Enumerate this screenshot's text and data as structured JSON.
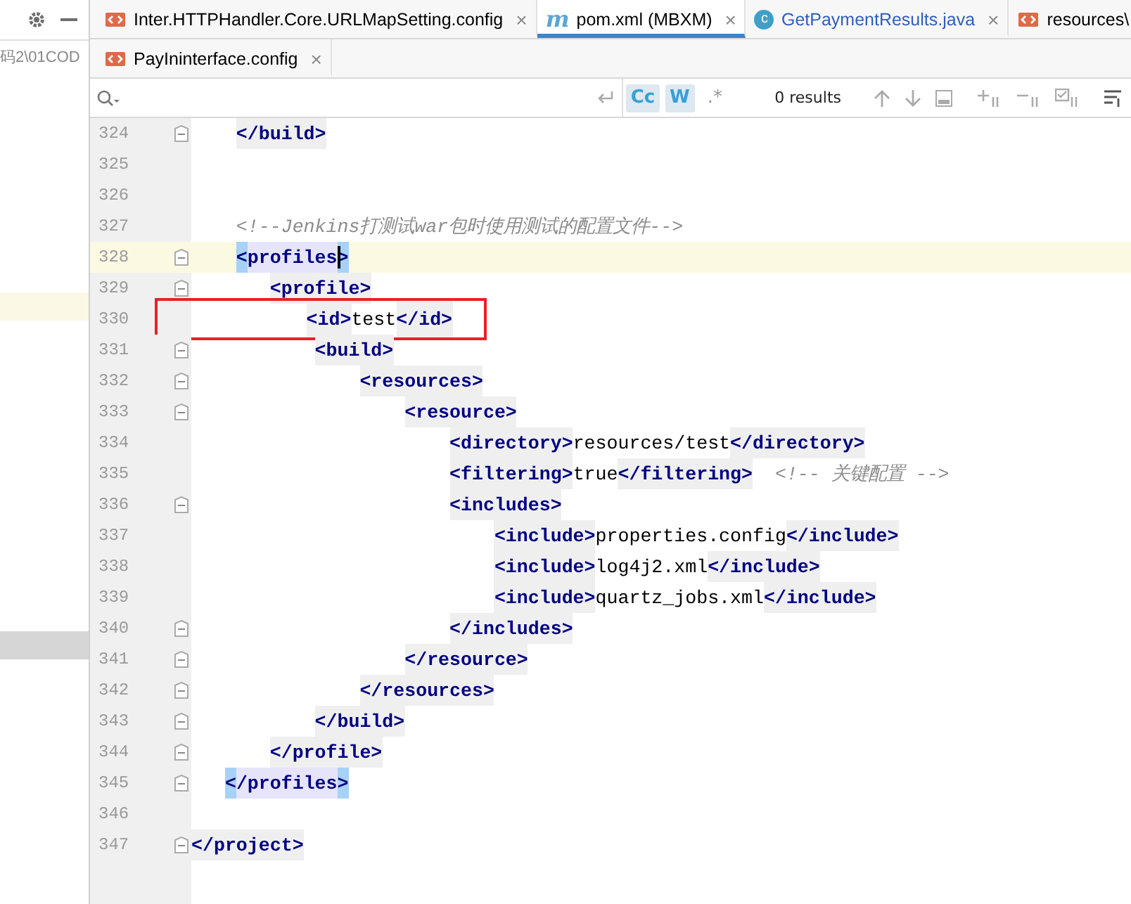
{
  "project_panel": {
    "path": "码2\\01COD",
    "rows": [
      {
        "kind": "highlight"
      },
      {
        "kind": "grey"
      }
    ]
  },
  "tabs": [
    {
      "label": "Inter.HTTPHandler.Core.URLMapSetting.config",
      "icon": {
        "kind": "xml"
      },
      "selected": false,
      "close": "×",
      "color": "#000000"
    },
    {
      "label": "pom.xml (MBXM)",
      "icon": {
        "kind": "maven",
        "glyph": "m"
      },
      "selected": true,
      "close": "×",
      "color": "#000000"
    },
    {
      "label": "GetPaymentResults.java",
      "icon": {
        "kind": "class",
        "glyph": "c"
      },
      "selected": false,
      "close": "×",
      "color": "#2f5fbf"
    },
    {
      "label": "resources\\",
      "icon": {
        "kind": "xml"
      },
      "selected": false,
      "color": "#000000"
    },
    {
      "label": "PayIninterface.config",
      "icon": {
        "kind": "xml"
      },
      "selected": false,
      "close": "×",
      "color": "#000000"
    }
  ],
  "search": {
    "results": "0 results",
    "match_case": {
      "label": "Cc",
      "selected": true
    },
    "words": {
      "label": "W",
      "selected": true
    },
    "regex": {
      "label": ".*",
      "selected": false
    }
  },
  "lines": [
    {
      "number": "324",
      "fold": true,
      "current": false,
      "tokens": [
        {
          "kind": "tag",
          "text": "    </build>"
        }
      ]
    },
    {
      "number": "325",
      "fold": false,
      "current": false
    },
    {
      "number": "326",
      "fold": false,
      "current": false
    },
    {
      "number": "327",
      "fold": false,
      "current": false,
      "tokens": [
        {
          "kind": "comment",
          "text": "    <!--Jenkins打测试war包时使用测试的配置文件-->"
        }
      ]
    },
    {
      "number": "328",
      "fold": true,
      "current": true,
      "tokens": [
        {
          "kind": "match",
          "text": "    <profiles>",
          "caret": true
        }
      ]
    },
    {
      "number": "329",
      "fold": true,
      "current": false,
      "tokens": [
        {
          "kind": "tag",
          "text": "       <profile>"
        }
      ]
    },
    {
      "number": "330",
      "fold": false,
      "current": false,
      "boxed": true,
      "tokens": [
        {
          "kind": "tag",
          "text": "           <id>"
        },
        {
          "kind": "text",
          "text": "test"
        },
        {
          "kind": "tag",
          "text": "</id>"
        }
      ]
    },
    {
      "number": "331",
      "fold": true,
      "current": false,
      "tokens": [
        {
          "kind": "tag",
          "text": "           <build>"
        }
      ]
    },
    {
      "number": "332",
      "fold": true,
      "current": false,
      "tokens": [
        {
          "kind": "tag",
          "text": "               <resources>"
        }
      ]
    },
    {
      "number": "333",
      "fold": true,
      "current": false,
      "tokens": [
        {
          "kind": "tag",
          "text": "                   <resource>"
        }
      ]
    },
    {
      "number": "334",
      "fold": false,
      "current": false,
      "tokens": [
        {
          "kind": "tag",
          "text": "                       <directory>"
        },
        {
          "kind": "text",
          "text": "resources/test"
        },
        {
          "kind": "tag",
          "text": "</directory>"
        }
      ]
    },
    {
      "number": "335",
      "fold": false,
      "current": false,
      "tokens": [
        {
          "kind": "tag",
          "text": "                       <filtering>"
        },
        {
          "kind": "text",
          "text": "true"
        },
        {
          "kind": "tag",
          "text": "</filtering>"
        },
        {
          "kind": "comment",
          "text": "  <!-- 关键配置 -->"
        }
      ]
    },
    {
      "number": "336",
      "fold": true,
      "current": false,
      "tokens": [
        {
          "kind": "tag",
          "text": "                       <includes>"
        }
      ]
    },
    {
      "number": "337",
      "fold": false,
      "current": false,
      "tokens": [
        {
          "kind": "tag",
          "text": "                           <include>"
        },
        {
          "kind": "text",
          "text": "properties.config"
        },
        {
          "kind": "tag",
          "text": "</include>"
        }
      ]
    },
    {
      "number": "338",
      "fold": false,
      "current": false,
      "tokens": [
        {
          "kind": "tag",
          "text": "                           <include>"
        },
        {
          "kind": "text",
          "text": "log4j2.xml"
        },
        {
          "kind": "tag",
          "text": "</include>"
        }
      ]
    },
    {
      "number": "339",
      "fold": false,
      "current": false,
      "tokens": [
        {
          "kind": "tag",
          "text": "                           <include>"
        },
        {
          "kind": "text",
          "text": "quartz_jobs.xml"
        },
        {
          "kind": "tag",
          "text": "</include>"
        }
      ]
    },
    {
      "number": "340",
      "fold": true,
      "current": false,
      "tokens": [
        {
          "kind": "tag",
          "text": "                       </includes>"
        }
      ]
    },
    {
      "number": "341",
      "fold": true,
      "current": false,
      "tokens": [
        {
          "kind": "tag",
          "text": "                   </resource>"
        }
      ]
    },
    {
      "number": "342",
      "fold": true,
      "current": false,
      "tokens": [
        {
          "kind": "tag",
          "text": "               </resources>"
        }
      ]
    },
    {
      "number": "343",
      "fold": true,
      "current": false,
      "tokens": [
        {
          "kind": "tag",
          "text": "           </build>"
        }
      ]
    },
    {
      "number": "344",
      "fold": true,
      "current": false,
      "tokens": [
        {
          "kind": "tag",
          "text": "       </profile>"
        }
      ]
    },
    {
      "number": "345",
      "fold": true,
      "current": false,
      "tokens": [
        {
          "kind": "match",
          "text": "   </profiles>"
        }
      ]
    },
    {
      "number": "346",
      "fold": false,
      "current": false
    },
    {
      "number": "347",
      "fold": true,
      "current": false,
      "tokens": [
        {
          "kind": "tag",
          "text": "</project>"
        }
      ]
    }
  ]
}
